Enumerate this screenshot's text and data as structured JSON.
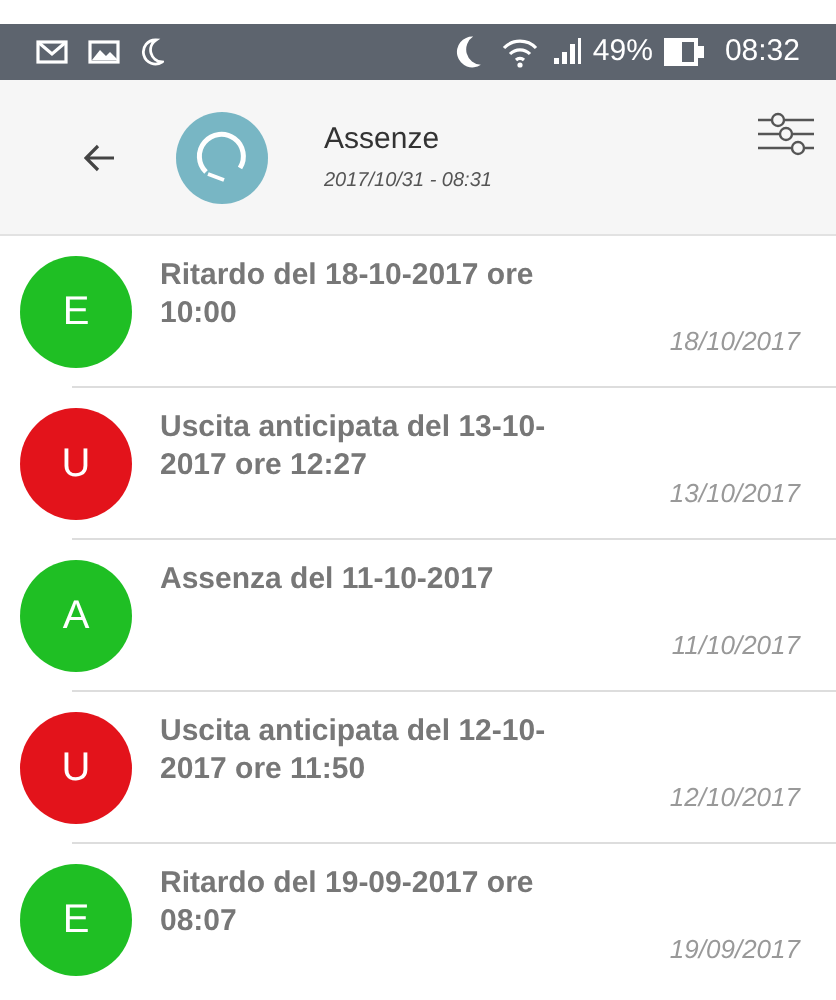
{
  "status_bar": {
    "battery": "49%",
    "time": "08:32"
  },
  "header": {
    "title": "Assenze",
    "subtitle": "2017/10/31 - 08:31"
  },
  "items": [
    {
      "letter": "E",
      "color": "#1fbf24",
      "text": "Ritardo del 18-10-2017 ore 10:00",
      "date": "18/10/2017"
    },
    {
      "letter": "U",
      "color": "#e3131b",
      "text": "Uscita anticipata del 13-10-2017 ore 12:27",
      "date": "13/10/2017"
    },
    {
      "letter": "A",
      "color": "#1fbf24",
      "text": "Assenza del 11-10-2017",
      "date": "11/10/2017"
    },
    {
      "letter": "U",
      "color": "#e3131b",
      "text": "Uscita anticipata del 12-10-2017 ore 11:50",
      "date": "12/10/2017"
    },
    {
      "letter": "E",
      "color": "#1fbf24",
      "text": "Ritardo del 19-09-2017 ore 08:07",
      "date": "19/09/2017"
    }
  ]
}
